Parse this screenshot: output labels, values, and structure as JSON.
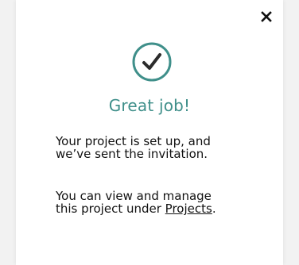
{
  "modal": {
    "close_label": "X",
    "title": "Great job!",
    "message_line1": "Your project is set up, and",
    "message_line2": "we’ve sent the invitation.",
    "manage_text_line1": "You can view and manage",
    "manage_text_prefix": "this project under ",
    "projects_link": "Projects",
    "manage_text_suffix": "."
  },
  "colors": {
    "accent": "#3f8f8a",
    "check_stroke": "#2b2b2b",
    "text": "#111111"
  },
  "icons": {
    "close": "close-icon",
    "success": "check-circle-icon"
  }
}
